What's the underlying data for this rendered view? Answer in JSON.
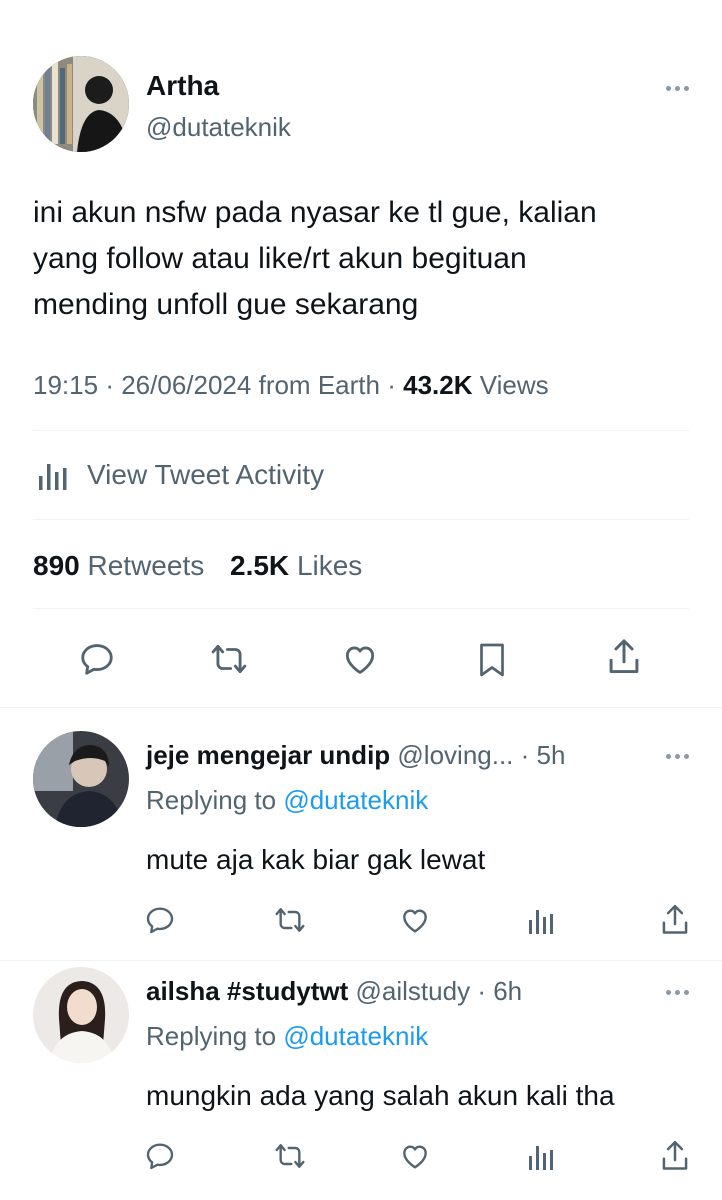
{
  "tweet": {
    "author_name": "Artha",
    "author_handle": "@dutateknik",
    "text_lines": [
      "ini akun nsfw pada nyasar ke tl gue, kalian",
      "yang follow atau like/rt akun begituan",
      "mending unfoll gue sekarang"
    ],
    "time": "19:15",
    "sep1": "·",
    "date": "26/06/2024",
    "source": "from Earth",
    "sep2": "·",
    "views_count": "43.2K",
    "views_label": "Views",
    "activity_label": "View Tweet Activity",
    "retweets_count": "890",
    "retweets_label": "Retweets",
    "likes_count": "2.5K",
    "likes_label": "Likes"
  },
  "replies": [
    {
      "name": "jeje mengejar undip",
      "handle": "@loving...",
      "sep": "·",
      "time": "5h",
      "replying_to_label": "Replying to",
      "replying_to_handle": "@dutateknik",
      "text": "mute aja kak biar gak lewat"
    },
    {
      "name": "ailsha #studytwt",
      "handle": "@ailstudy",
      "sep": "·",
      "time": "6h",
      "replying_to_label": "Replying to",
      "replying_to_handle": "@dutateknik",
      "text": "mungkin ada yang salah akun kali tha"
    }
  ],
  "icons": {
    "reply": "reply-icon",
    "retweet": "retweet-icon",
    "like": "heart-icon",
    "bookmark": "bookmark-icon",
    "share": "share-icon",
    "analytics": "analytics-icon",
    "more": "more-icon"
  },
  "colors": {
    "text": "#0f1419",
    "muted": "#536471",
    "link": "#1d9bf0",
    "divider": "#eff3f4"
  }
}
